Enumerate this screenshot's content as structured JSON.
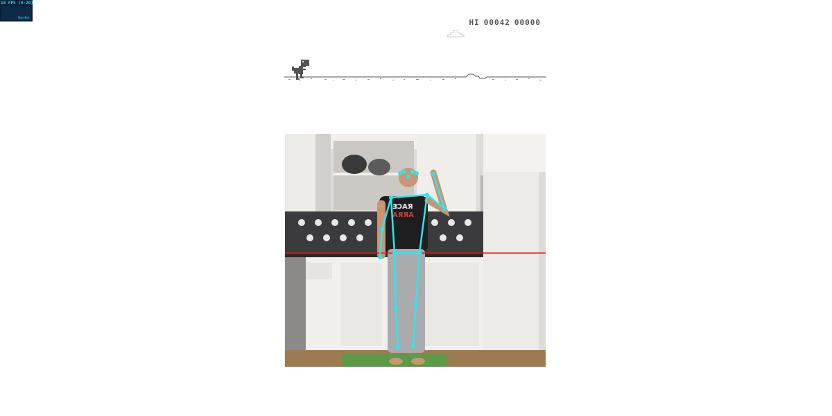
{
  "stats": {
    "fps_text": "18 FPS (0-20)",
    "graph_label": "MoveNet"
  },
  "game": {
    "hi_label": "HI",
    "hi_score": "00042",
    "score": "00000"
  },
  "colors": {
    "skeleton": "#2ee6ec",
    "threshold_line": "#e01b12",
    "game_ink": "#535353",
    "stats_bg": "#0b1f33",
    "stats_text": "#29d7ff"
  },
  "pose": {
    "keypoint_color": "#2ee6ec",
    "keypoint_count": 17
  }
}
